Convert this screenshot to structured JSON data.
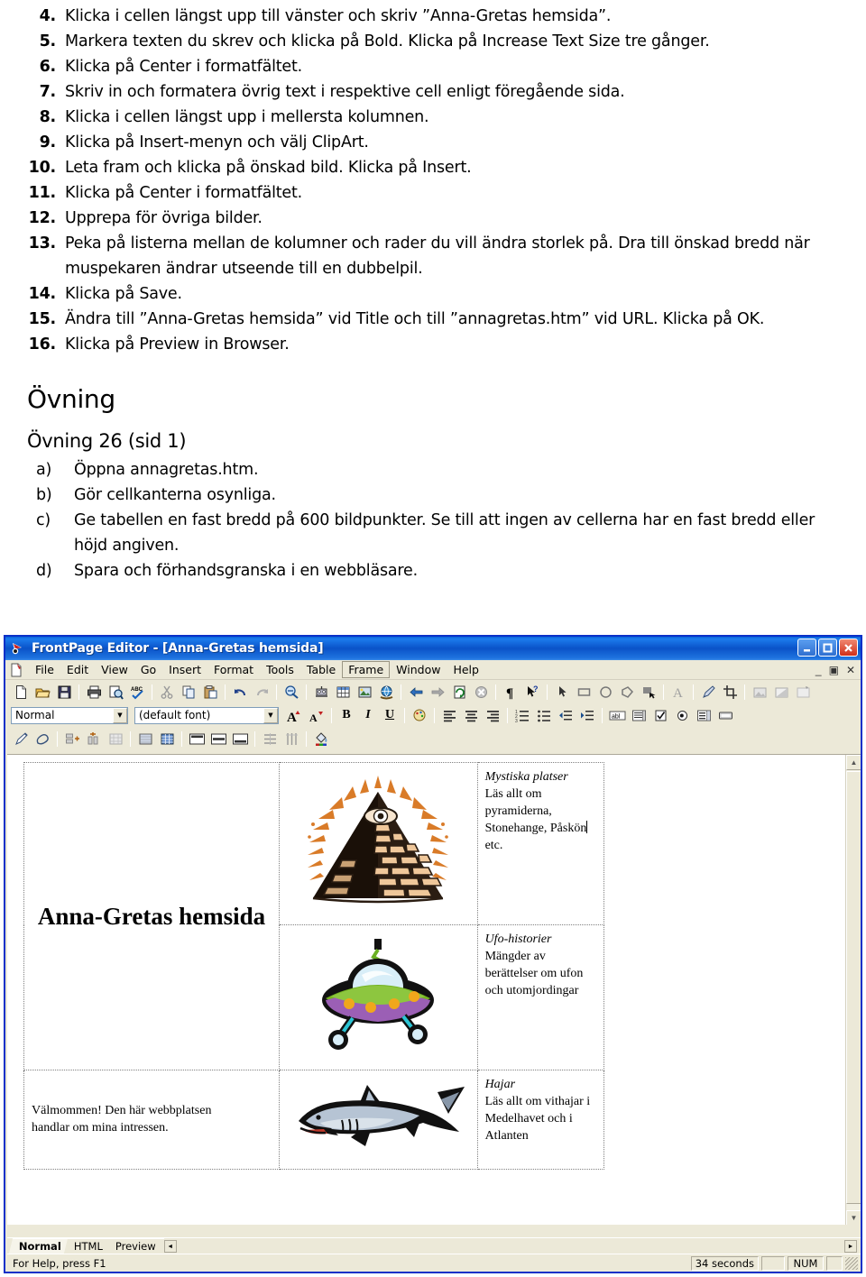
{
  "document": {
    "steps": [
      {
        "num": "4.",
        "text": "Klicka i cellen längst upp till vänster och skriv ”Anna-Gretas hemsida”."
      },
      {
        "num": "5.",
        "text": "Markera texten du skrev och klicka på Bold. Klicka på Increase Text Size tre gånger."
      },
      {
        "num": "6.",
        "text": "Klicka på Center i formatfältet."
      },
      {
        "num": "7.",
        "text": "Skriv in och formatera övrig text i respektive cell enligt föregående sida."
      },
      {
        "num": "8.",
        "text": "Klicka i cellen längst upp i mellersta kolumnen."
      },
      {
        "num": "9.",
        "text": "Klicka på Insert-menyn och välj ClipArt."
      },
      {
        "num": "10.",
        "text": "Leta fram och klicka på önskad bild. Klicka på Insert."
      },
      {
        "num": "11.",
        "text": "Klicka på Center i formatfältet."
      },
      {
        "num": "12.",
        "text": "Upprepa för övriga bilder."
      },
      {
        "num": "13.",
        "text": "Peka på listerna mellan de kolumner och rader du vill ändra storlek på. Dra till önskad bredd när muspekaren ändrar utseende till en dubbelpil."
      },
      {
        "num": "14.",
        "text": "Klicka på Save."
      },
      {
        "num": "15.",
        "text": "Ändra till ”Anna-Gretas hemsida” vid Title och till ”annagretas.htm” vid URL. Klicka på OK."
      },
      {
        "num": "16.",
        "text": "Klicka på Preview in Browser."
      }
    ],
    "heading": "Övning",
    "subheading": "Övning 26 (sid 1)",
    "subitems": [
      {
        "label": "a)",
        "text": "Öppna annagretas.htm."
      },
      {
        "label": "b)",
        "text": "Gör cellkanterna osynliga."
      },
      {
        "label": "c)",
        "text": "Ge tabellen en fast bredd på 600 bildpunkter. Se till att ingen av cellerna har en fast bredd eller höjd angiven."
      },
      {
        "label": "d)",
        "text": "Spara och förhandsgranska i en webbläsare."
      }
    ]
  },
  "app": {
    "title": "FrontPage Editor - [Anna-Gretas hemsida]",
    "window_buttons": {
      "minimize": "_",
      "maximize": "□",
      "close": "✕"
    },
    "mdi_buttons": {
      "minimize": "_",
      "restore": "▣",
      "close": "✕"
    },
    "menu": [
      {
        "label": "File"
      },
      {
        "label": "Edit"
      },
      {
        "label": "View"
      },
      {
        "label": "Go"
      },
      {
        "label": "Insert"
      },
      {
        "label": "Format"
      },
      {
        "label": "Tools"
      },
      {
        "label": "Table"
      },
      {
        "label": "Frame"
      },
      {
        "label": "Window"
      },
      {
        "label": "Help"
      }
    ],
    "standard_toolbar": [
      "new-page-icon",
      "open-icon",
      "save-icon",
      "sep",
      "print-icon",
      "print-preview-icon",
      "spelling-icon",
      "sep",
      "cut-icon",
      "copy-icon",
      "paste-icon",
      "sep",
      "undo-icon",
      "redo-icon",
      "sep",
      "hyperlink-icon",
      "sep",
      "webbot-icon",
      "insert-table-icon",
      "insert-image-icon",
      "preview-in-browser-icon",
      "sep",
      "back-icon",
      "forward-icon",
      "refresh-icon",
      "stop-icon",
      "sep",
      "show-paragraph-marks-icon",
      "help-pointer-icon",
      "sep",
      "select-arrow-icon",
      "rectangle-hotspot-icon",
      "circle-hotspot-icon",
      "polygon-hotspot-icon",
      "highlight-hotspots-icon",
      "sep",
      "text-icon",
      "sep",
      "pencil-icon",
      "crop-icon",
      "sep",
      "image-transparent-icon",
      "image-washout-icon",
      "image-restore-icon"
    ],
    "format_toolbar": {
      "style_value": "Normal",
      "font_value": "(default font)",
      "buttons": [
        "increase-text-size-icon",
        "decrease-text-size-icon",
        "sep",
        "bold-icon",
        "italic-icon",
        "underline-icon",
        "sep",
        "text-color-icon",
        "sep",
        "align-left-icon",
        "align-center-icon",
        "align-right-icon",
        "sep",
        "numbered-list-icon",
        "bulleted-list-icon",
        "decrease-indent-icon",
        "increase-indent-icon"
      ],
      "bold_label": "B",
      "italic_label": "I",
      "underline_label": "U"
    },
    "forms_toolbar": [
      "one-line-text-box-icon",
      "scrolling-text-box-icon",
      "check-box-icon",
      "radio-button-icon",
      "drop-down-menu-icon",
      "push-button-icon"
    ],
    "table_toolbar": [
      "draw-table-icon",
      "eraser-icon",
      "sep",
      "insert-rows-icon",
      "insert-columns-icon",
      "delete-cells-icon",
      "sep",
      "merge-cells-icon",
      "split-cells-icon",
      "sep",
      "align-top-icon",
      "center-vertically-icon",
      "align-bottom-icon",
      "sep",
      "distribute-rows-evenly-icon",
      "distribute-columns-evenly-icon",
      "sep",
      "fill-color-icon"
    ],
    "view_tabs": [
      {
        "label": "Normal",
        "active": true
      },
      {
        "label": "HTML",
        "active": false
      },
      {
        "label": "Preview",
        "active": false
      }
    ],
    "status": {
      "message": "For Help, press F1",
      "time": "34 seconds",
      "num_lock": "NUM"
    },
    "colors": {
      "titlebar_blue": "#0a52c8",
      "window_border": "#0a30c8",
      "toolbar_face": "#ece9d8",
      "close_button": "#d0301a"
    }
  },
  "webpage": {
    "cells": {
      "site_title": "Anna-Gretas hemsida",
      "pyramid_image": "pyramid-clipart",
      "mystic_heading": "Mystiska platser",
      "mystic_body_1": "Läs allt om",
      "mystic_body_2": "pyramiderna,",
      "mystic_body_3": "Stonehange, Påskön",
      "mystic_body_4": "etc.",
      "ufo_image": "ufo-clipart",
      "ufo_heading": "Ufo-historier",
      "ufo_body_1": "Mängder av",
      "ufo_body_2": "berättelser om ufon",
      "ufo_body_3": "och utomjordingar",
      "welcome_1": "Välmommen! Den här webbplatsen",
      "welcome_2": "handlar om mina intressen.",
      "shark_image": "shark-clipart",
      "shark_heading": "Hajar",
      "shark_body_1": "Läs allt om vithajar i",
      "shark_body_2": "Medelhavet och i",
      "shark_body_3": "Atlanten"
    }
  }
}
